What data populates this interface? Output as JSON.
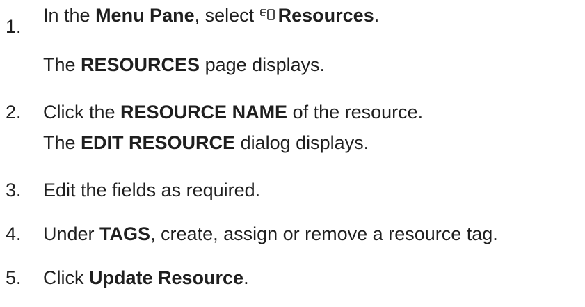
{
  "steps": [
    {
      "number": "1.",
      "pre": "In the ",
      "bold1": "Menu Pane",
      "mid": ", select ",
      "icon": "resources-icon",
      "bold2": "Resources",
      "post": ".",
      "result_pre": "The ",
      "result_bold": "RESOURCES",
      "result_post": " page displays."
    },
    {
      "number": "2.",
      "pre": "Click the ",
      "bold1": "RESOURCE NAME",
      "post": " of the resource.",
      "result_pre": "The ",
      "result_bold": "EDIT RESOURCE",
      "result_post": " dialog displays."
    },
    {
      "number": "3.",
      "text": "Edit the fields as required."
    },
    {
      "number": "4.",
      "pre": "Under ",
      "bold1": "TAGS",
      "post": ", create, assign or remove a resource tag."
    },
    {
      "number": "5.",
      "pre": "Click ",
      "bold1": "Update Resource",
      "post": "."
    }
  ]
}
